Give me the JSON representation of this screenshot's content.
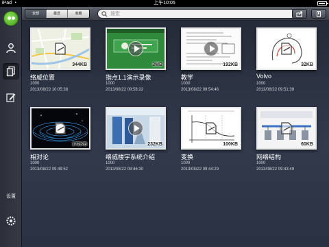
{
  "status_bar": {
    "carrier": "iPad",
    "time": "上午10:05"
  },
  "topbar": {
    "segments": [
      "全部",
      "最近",
      "收藏"
    ],
    "search_placeholder": "搜索"
  },
  "sidebar": {
    "items": [
      "user-icon",
      "documents-icon",
      "edit-icon",
      "settings-icon"
    ],
    "bottom_label": "设置"
  },
  "files": [
    {
      "title": "络威位置",
      "count": "1000",
      "time": "2013/08/22 10:05:38",
      "size": "344KB",
      "type": "document",
      "thumb": "map"
    },
    {
      "title": "指点1.1演示录像",
      "count": "1000",
      "time": "2013/08/22 09:58:22",
      "size": "3MB",
      "type": "video",
      "thumb": "green"
    },
    {
      "title": "教学",
      "count": "1000",
      "time": "2013/08/22 09:54:46",
      "size": "192KB",
      "type": "video",
      "thumb": "paper"
    },
    {
      "title": "Volvo",
      "count": "1000",
      "time": "2013/08/22 09:51:39",
      "size": "32KB",
      "type": "document",
      "thumb": "drawing"
    },
    {
      "title": "相对论",
      "count": "1000",
      "time": "2013/08/22 09:49:52",
      "size": "172KB",
      "type": "document",
      "thumb": "space"
    },
    {
      "title": "络威楼宇系统介绍",
      "count": "1000",
      "time": "2013/08/22 09:46:30",
      "size": "232KB",
      "type": "video",
      "thumb": "banner"
    },
    {
      "title": "变换",
      "count": "1000",
      "time": "2013/08/22 09:44:29",
      "size": "100KB",
      "type": "document",
      "thumb": "graph"
    },
    {
      "title": "网络结构",
      "count": "1000",
      "time": "2013/08/22 09:43:49",
      "size": "60KB",
      "type": "document",
      "thumb": "network"
    }
  ]
}
